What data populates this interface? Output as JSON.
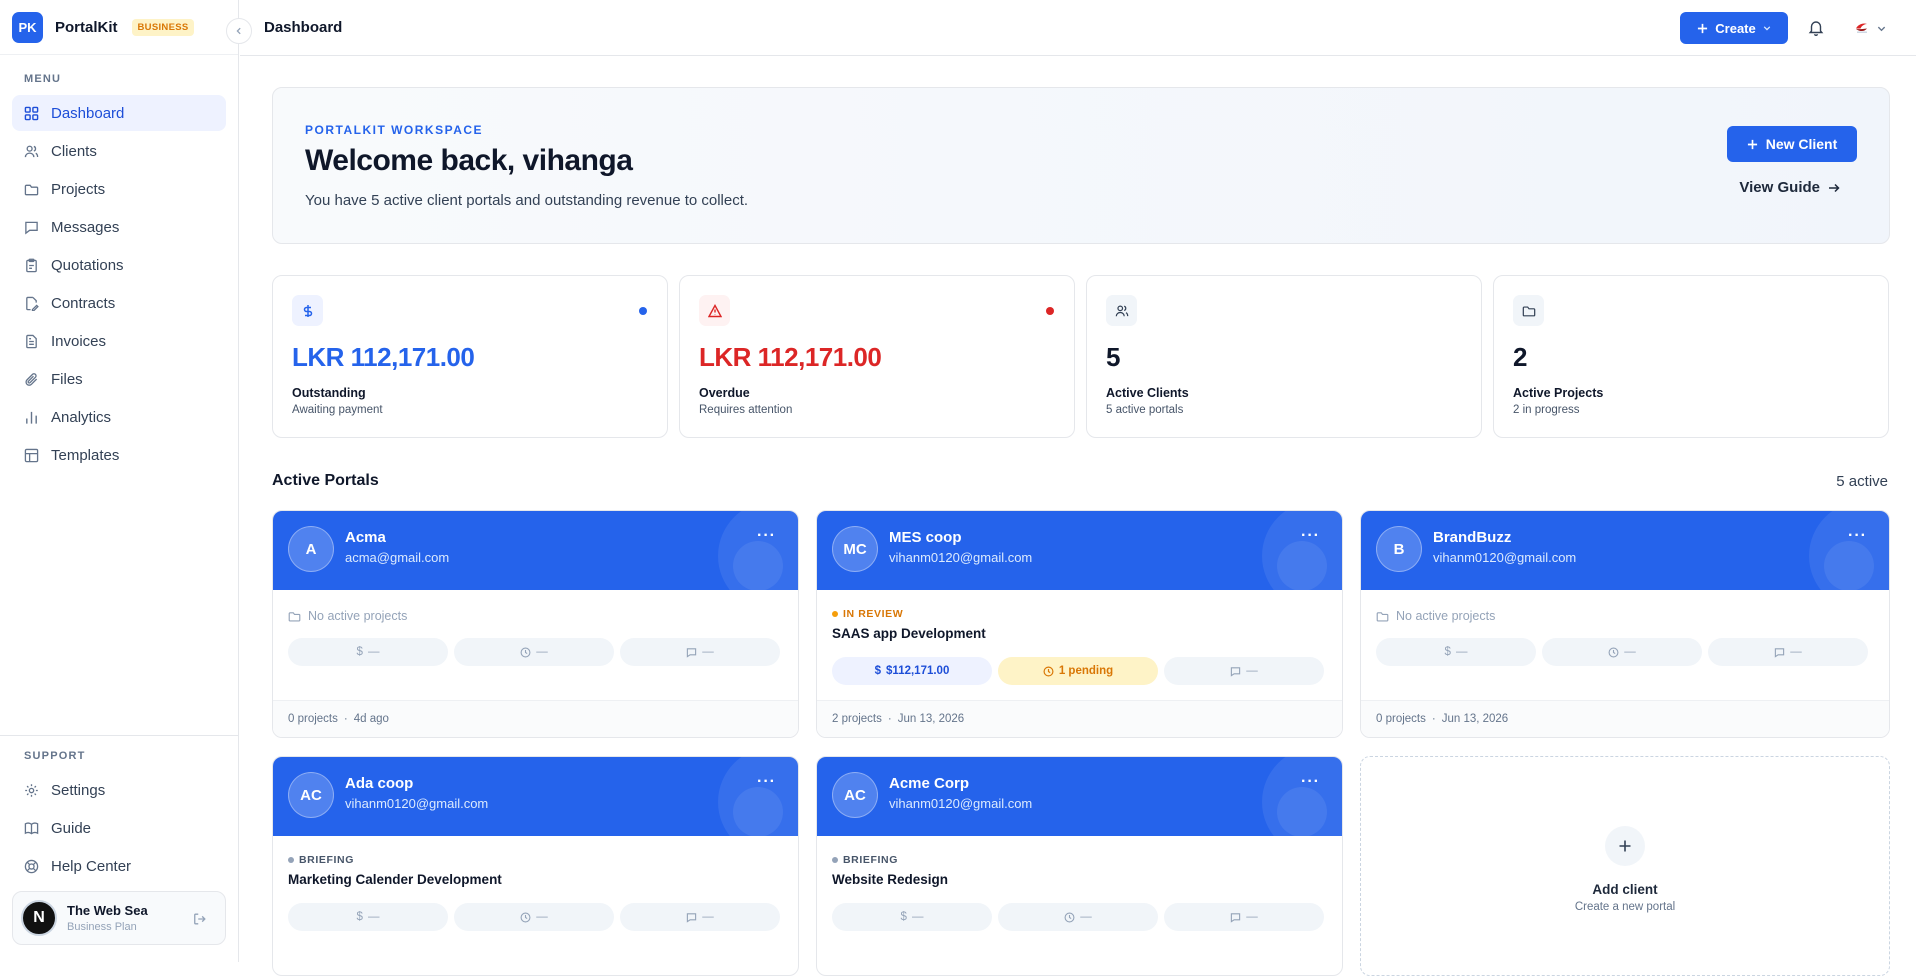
{
  "brand": {
    "logo": "PK",
    "name": "PortalKit",
    "badge": "BUSINESS"
  },
  "sidebar": {
    "menu_label": "MENU",
    "items": [
      {
        "label": "Dashboard",
        "icon": "grid-icon",
        "active": true
      },
      {
        "label": "Clients",
        "icon": "users-icon"
      },
      {
        "label": "Projects",
        "icon": "folder-icon"
      },
      {
        "label": "Messages",
        "icon": "message-icon"
      },
      {
        "label": "Quotations",
        "icon": "clipboard-icon"
      },
      {
        "label": "Contracts",
        "icon": "file-signature-icon"
      },
      {
        "label": "Invoices",
        "icon": "file-text-icon"
      },
      {
        "label": "Files",
        "icon": "paperclip-icon"
      },
      {
        "label": "Analytics",
        "icon": "bar-chart-icon"
      },
      {
        "label": "Templates",
        "icon": "layout-icon"
      }
    ],
    "support_label": "SUPPORT",
    "support_items": [
      {
        "label": "Settings",
        "icon": "gear-icon"
      },
      {
        "label": "Guide",
        "icon": "book-icon"
      },
      {
        "label": "Help Center",
        "icon": "lifebuoy-icon"
      }
    ],
    "user": {
      "avatar": "N",
      "name": "The Web Sea",
      "plan": "Business Plan"
    }
  },
  "topbar": {
    "title": "Dashboard",
    "create_label": "Create"
  },
  "hero": {
    "eyebrow": "PORTALKIT WORKSPACE",
    "title": "Welcome back, vihanga",
    "subtitle": "You have 5 active client portals and outstanding revenue to collect.",
    "new_client_label": "New Client",
    "view_guide_label": "View Guide"
  },
  "stats": [
    {
      "value": "LKR 112,171.00",
      "label": "Outstanding",
      "sub": "Awaiting payment",
      "icon": "dollar-icon",
      "color": "#2563eb"
    },
    {
      "value": "LKR 112,171.00",
      "label": "Overdue",
      "sub": "Requires attention",
      "icon": "alert-triangle-icon",
      "color": "#dc2626"
    },
    {
      "value": "5",
      "label": "Active Clients",
      "sub": "5 active portals",
      "icon": "users-icon",
      "color": "#0f172a"
    },
    {
      "value": "2",
      "label": "Active Projects",
      "sub": "2 in progress",
      "icon": "folder-icon",
      "color": "#0f172a"
    }
  ],
  "portals": {
    "title": "Active Portals",
    "count": "5 active",
    "no_projects_label": "No active projects",
    "dash": "—",
    "cards": [
      {
        "initials": "A",
        "name": "Acma",
        "email": "acma@gmail.com",
        "projects": "0 projects",
        "date": "4d ago"
      },
      {
        "initials": "MC",
        "name": "MES coop",
        "email": "vihanm0120@gmail.com",
        "status": "IN REVIEW",
        "project": "SAAS app Development",
        "amount": "$112,171.00",
        "pending": "1 pending",
        "projects": "2 projects",
        "date": "Jun 13, 2026"
      },
      {
        "initials": "B",
        "name": "BrandBuzz",
        "email": "vihanm0120@gmail.com",
        "projects": "0 projects",
        "date": "Jun 13, 2026"
      },
      {
        "initials": "AC",
        "name": "Ada coop",
        "email": "vihanm0120@gmail.com",
        "status": "BRIEFING",
        "project": "Marketing Calender Development"
      },
      {
        "initials": "AC",
        "name": "Acme Corp",
        "email": "vihanm0120@gmail.com",
        "status": "BRIEFING",
        "project": "Website Redesign"
      }
    ],
    "add": {
      "title": "Add client",
      "sub": "Create a new portal"
    }
  },
  "colors": {
    "accent": "#2563eb",
    "danger": "#dc2626",
    "review": "#f59e0b",
    "briefing": "#64748b"
  }
}
